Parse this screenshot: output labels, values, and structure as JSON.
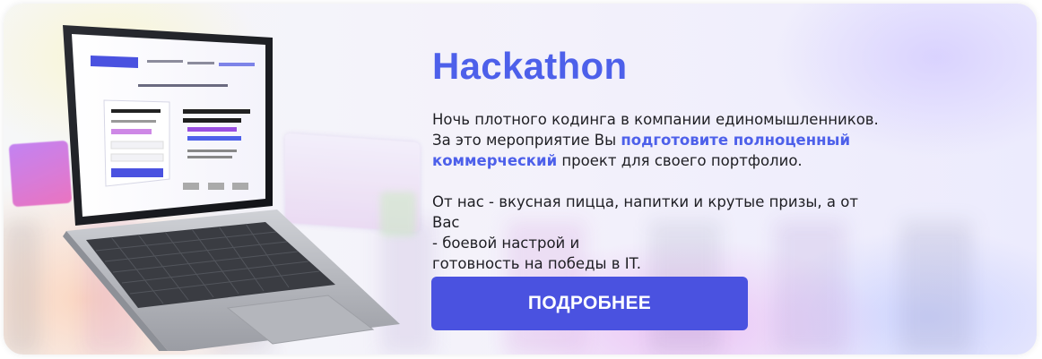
{
  "promo": {
    "title": "Hackathon",
    "line1": "Ночь плотного кодинга в компании единомышленников.",
    "line2_a": "За это мероприятие Вы ",
    "line2_b": "подготовите полноценный",
    "line3_a": "коммерческий",
    "line3_b": " проект для своего портфолио.",
    "line4": "От нас - вкусная пицца, напитки и крутые призы, а от Вас",
    "line5": "- боевой настрой и",
    "line6": "готовность на победы в IT.",
    "button_label": "ПОДРОБНЕЕ"
  },
  "colors": {
    "accent": "#4d60ea",
    "button": "#4a52e0",
    "text": "#1f1f24"
  }
}
